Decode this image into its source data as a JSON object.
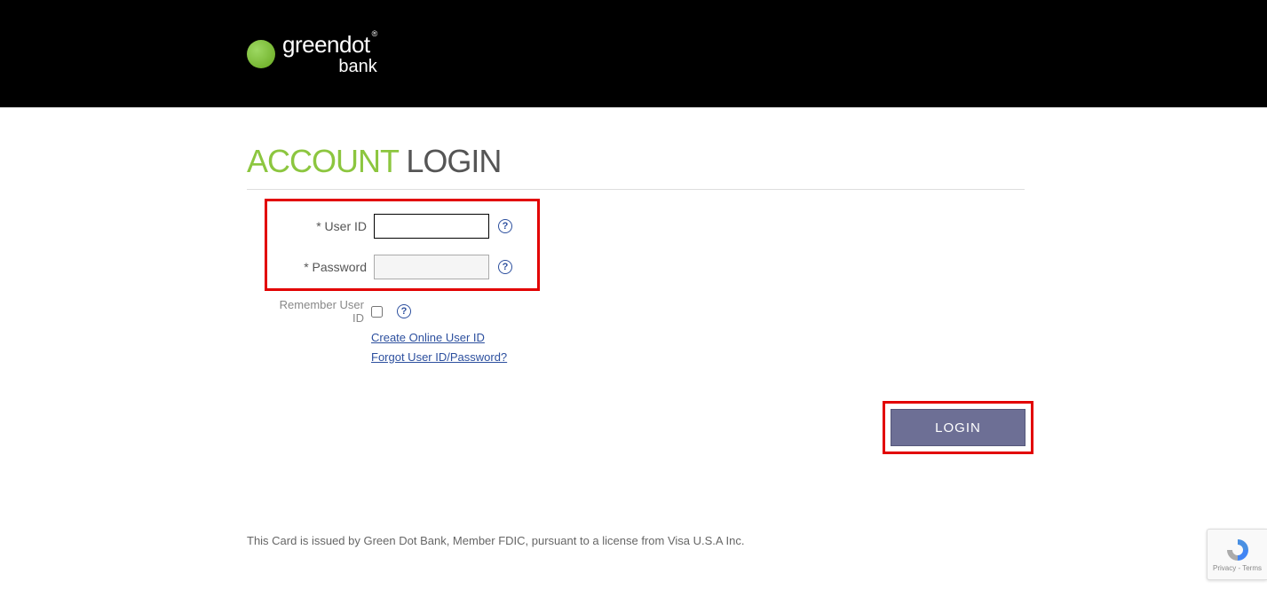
{
  "brand": {
    "name_top": "greendot",
    "name_bottom": "bank"
  },
  "title": {
    "accent": "ACCOUNT",
    "rest": "LOGIN"
  },
  "form": {
    "user_id": {
      "label": "User ID",
      "value": ""
    },
    "password": {
      "label": "Password",
      "value": ""
    },
    "remember": {
      "label": "Remember User ID"
    }
  },
  "links": {
    "create": "Create Online User ID",
    "forgot": "Forgot User ID/Password?"
  },
  "login_button": "LOGIN",
  "footer": "This Card is issued by Green Dot Bank, Member FDIC, pursuant to a license from Visa U.S.A Inc.",
  "recaptcha": {
    "privacy": "Privacy",
    "terms": "Terms"
  }
}
